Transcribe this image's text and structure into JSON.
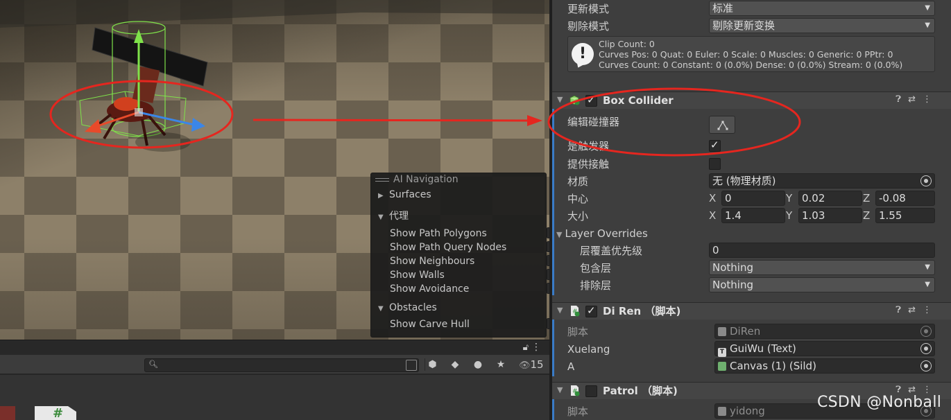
{
  "scene": {
    "ai_navigation": {
      "title": "AI Navigation",
      "surfaces": "Surfaces",
      "agents_section": "代理",
      "agent_options": [
        {
          "label": "Show Path Polygons",
          "checked": false
        },
        {
          "label": "Show Path Query Nodes",
          "checked": false
        },
        {
          "label": "Show Neighbours",
          "checked": true
        },
        {
          "label": "Show Walls",
          "checked": false
        },
        {
          "label": "Show Avoidance",
          "checked": false
        }
      ],
      "obstacles_section": "Obstacles",
      "obstacle_options": [
        {
          "label": "Show Carve Hull",
          "checked": false
        }
      ]
    }
  },
  "project": {
    "search_placeholder": "",
    "hidden_count": "15",
    "thumb_glyph": "#"
  },
  "inspector": {
    "animator": {
      "update_mode_label": "更新模式",
      "update_mode_value": "标准",
      "culling_mode_label": "剔除模式",
      "culling_mode_value": "剔除更新变换",
      "info_lines": [
        "Clip Count: 0",
        "Curves Pos: 0 Quat: 0 Euler: 0 Scale: 0 Muscles: 0 Generic: 0 PPtr: 0",
        "Curves Count: 0 Constant: 0 (0.0%) Dense: 0 (0.0%) Stream: 0 (0.0%)"
      ]
    },
    "box_collider": {
      "title": "Box Collider",
      "enabled": true,
      "edit_collider_label": "编辑碰撞器",
      "is_trigger_label": "是触发器",
      "is_trigger": true,
      "provides_contacts_label": "提供接触",
      "provides_contacts": false,
      "material_label": "材质",
      "material_value": "无 (物理材质)",
      "center_label": "中心",
      "center": {
        "x": "0",
        "y": "0.02",
        "z": "-0.08"
      },
      "size_label": "大小",
      "size": {
        "x": "1.4",
        "y": "1.03",
        "z": "1.55"
      },
      "layer_overrides_label": "Layer Overrides",
      "layer_priority_label": "层覆盖优先级",
      "layer_priority_value": "0",
      "include_layers_label": "包含层",
      "include_layers_value": "Nothing",
      "exclude_layers_label": "排除层",
      "exclude_layers_value": "Nothing"
    },
    "di_ren": {
      "title": "Di Ren （脚本)",
      "enabled": true,
      "script_label": "脚本",
      "script_value": "DiRen",
      "xuelang_label": "Xuelang",
      "xuelang_value": "GuiWu (Text)",
      "a_label": "A",
      "a_value": "Canvas (1) (Sild)"
    },
    "patrol": {
      "title": "Patrol （脚本)",
      "enabled": false,
      "script_label": "脚本",
      "script_value": "yidong"
    }
  },
  "watermark": "CSDN @Nonball",
  "colors": {
    "annotation_red": "#e5261f",
    "accent_blue": "#3a7cc8",
    "gizmo_green": "#7fe34a"
  }
}
